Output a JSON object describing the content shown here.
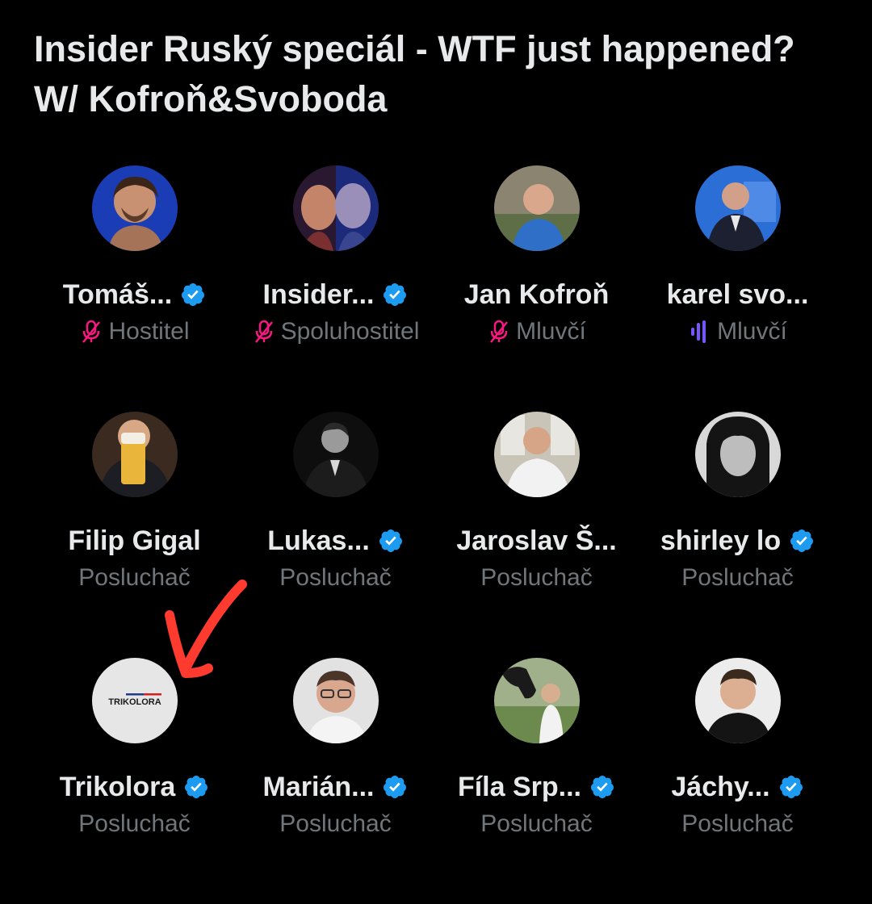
{
  "space": {
    "title": "Insider Ruský speciál - WTF just happened? W/ Kofroň&Svoboda"
  },
  "colors": {
    "background": "#000000",
    "text": "#e7e9ea",
    "muted": "#71767b",
    "verified": "#1d9bf0",
    "muted_mic": "#f91880",
    "speaking": "#7856ff",
    "annotation_arrow": "#ff3b30"
  },
  "participants": [
    {
      "name": "Tomáš...",
      "verified": true,
      "role": "Hostitel",
      "role_icon": "mic-muted-icon"
    },
    {
      "name": "Insider...",
      "verified": true,
      "role": "Spoluhostitel",
      "role_icon": "mic-muted-icon"
    },
    {
      "name": "Jan Kofroň",
      "verified": false,
      "role": "Mluvčí",
      "role_icon": "mic-muted-icon"
    },
    {
      "name": "karel svo...",
      "verified": false,
      "role": "Mluvčí",
      "role_icon": "speaking-bars-icon"
    },
    {
      "name": "Filip Gigal",
      "verified": false,
      "role": "Posluchač",
      "role_icon": ""
    },
    {
      "name": "Lukas...",
      "verified": true,
      "role": "Posluchač",
      "role_icon": ""
    },
    {
      "name": "Jaroslav Š...",
      "verified": false,
      "role": "Posluchač",
      "role_icon": ""
    },
    {
      "name": "shirley lo",
      "verified": true,
      "role": "Posluchač",
      "role_icon": ""
    },
    {
      "name": "Trikolora",
      "verified": true,
      "role": "Posluchač",
      "role_icon": "",
      "avatar_text": "TRIKOLORA"
    },
    {
      "name": "Marián...",
      "verified": true,
      "role": "Posluchač",
      "role_icon": ""
    },
    {
      "name": "Fíla Srp...",
      "verified": true,
      "role": "Posluchač",
      "role_icon": ""
    },
    {
      "name": "Jáchy...",
      "verified": true,
      "role": "Posluchač",
      "role_icon": ""
    }
  ]
}
